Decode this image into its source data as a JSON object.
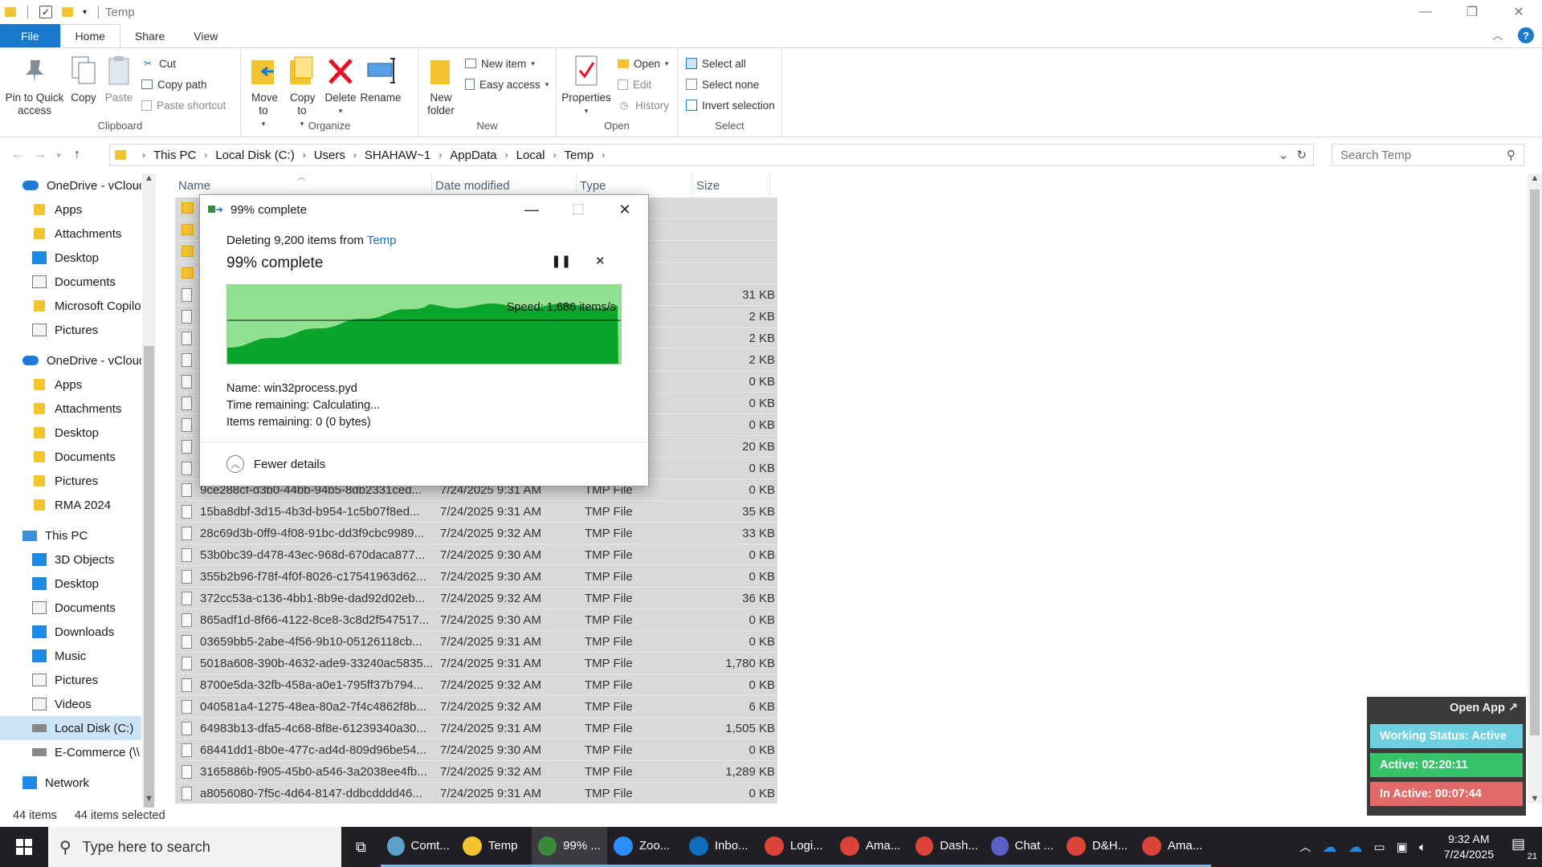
{
  "window": {
    "title": "Temp"
  },
  "tabs": {
    "file": "File",
    "home": "Home",
    "share": "Share",
    "view": "View"
  },
  "ribbon": {
    "clipboard": {
      "label": "Clipboard",
      "pin": "Pin to Quick access",
      "copy": "Copy",
      "paste": "Paste",
      "cut": "Cut",
      "copy_path": "Copy path",
      "paste_shortcut": "Paste shortcut"
    },
    "organize": {
      "label": "Organize",
      "move_to": "Move to",
      "copy_to": "Copy to",
      "delete": "Delete",
      "rename": "Rename"
    },
    "new": {
      "label": "New",
      "new_folder": "New folder",
      "new_item": "New item",
      "easy_access": "Easy access"
    },
    "open": {
      "label": "Open",
      "properties": "Properties",
      "open": "Open",
      "edit": "Edit",
      "history": "History"
    },
    "select": {
      "label": "Select",
      "select_all": "Select all",
      "select_none": "Select none",
      "invert": "Invert selection"
    }
  },
  "address": {
    "crumbs": [
      "This PC",
      "Local Disk (C:)",
      "Users",
      "SHAHAW~1",
      "AppData",
      "Local",
      "Temp"
    ],
    "search_placeholder": "Search Temp"
  },
  "nav": {
    "items": [
      {
        "label": "OneDrive - vCloud",
        "kind": "cloud"
      },
      {
        "label": "Apps",
        "kind": "folder"
      },
      {
        "label": "Attachments",
        "kind": "folder"
      },
      {
        "label": "Desktop",
        "kind": "blue"
      },
      {
        "label": "Documents",
        "kind": "doc"
      },
      {
        "label": "Microsoft Copilot",
        "kind": "folder"
      },
      {
        "label": "Pictures",
        "kind": "doc"
      },
      {
        "label": "OneDrive - vCloud",
        "kind": "cloud"
      },
      {
        "label": "Apps",
        "kind": "folder"
      },
      {
        "label": "Attachments",
        "kind": "folder"
      },
      {
        "label": "Desktop",
        "kind": "folder"
      },
      {
        "label": "Documents",
        "kind": "folder"
      },
      {
        "label": "Pictures",
        "kind": "folder"
      },
      {
        "label": "RMA 2024",
        "kind": "folder"
      },
      {
        "label": "This PC",
        "kind": "pc"
      },
      {
        "label": "3D Objects",
        "kind": "blue"
      },
      {
        "label": "Desktop",
        "kind": "blue"
      },
      {
        "label": "Documents",
        "kind": "doc"
      },
      {
        "label": "Downloads",
        "kind": "blue"
      },
      {
        "label": "Music",
        "kind": "blue"
      },
      {
        "label": "Pictures",
        "kind": "doc"
      },
      {
        "label": "Videos",
        "kind": "doc"
      },
      {
        "label": "Local Disk (C:)",
        "kind": "disk"
      },
      {
        "label": "E-Commerce (\\\\",
        "kind": "disk"
      },
      {
        "label": "Network",
        "kind": "blue"
      }
    ]
  },
  "columns": {
    "name": "Name",
    "date": "Date modified",
    "type": "Type",
    "size": "Size"
  },
  "files": [
    {
      "name": "",
      "date": "",
      "type": "",
      "size": "",
      "folder": true
    },
    {
      "name": "",
      "date": "",
      "type": "",
      "size": "",
      "folder": true
    },
    {
      "name": "",
      "date": "",
      "type": "",
      "size": "",
      "folder": true
    },
    {
      "name": "",
      "date": "",
      "type": "",
      "size": "",
      "folder": true
    },
    {
      "name": "",
      "date": "",
      "type": "",
      "size": "31 KB"
    },
    {
      "name": "",
      "date": "",
      "type": "",
      "size": "2 KB"
    },
    {
      "name": "",
      "date": "",
      "type": "",
      "size": "2 KB"
    },
    {
      "name": "",
      "date": "",
      "type": "",
      "size": "2 KB"
    },
    {
      "name": "",
      "date": "",
      "type": "",
      "size": "0 KB"
    },
    {
      "name": "",
      "date": "",
      "type": "",
      "size": "0 KB"
    },
    {
      "name": "",
      "date": "",
      "type": "",
      "size": "0 KB"
    },
    {
      "name": "",
      "date": "",
      "type": "",
      "size": "20 KB"
    },
    {
      "name": "",
      "date": "",
      "type": "",
      "size": "0 KB"
    },
    {
      "name": "9ce288cf-d3b0-44bb-94b5-8db2331ced...",
      "date": "7/24/2025 9:31 AM",
      "type": "TMP File",
      "size": "0 KB"
    },
    {
      "name": "15ba8dbf-3d15-4b3d-b954-1c5b07f8ed...",
      "date": "7/24/2025 9:31 AM",
      "type": "TMP File",
      "size": "35 KB"
    },
    {
      "name": "28c69d3b-0ff9-4f08-91bc-dd3f9cbc9989...",
      "date": "7/24/2025 9:32 AM",
      "type": "TMP File",
      "size": "33 KB"
    },
    {
      "name": "53b0bc39-d478-43ec-968d-670daca877...",
      "date": "7/24/2025 9:30 AM",
      "type": "TMP File",
      "size": "0 KB"
    },
    {
      "name": "355b2b96-f78f-4f0f-8026-c17541963d62...",
      "date": "7/24/2025 9:30 AM",
      "type": "TMP File",
      "size": "0 KB"
    },
    {
      "name": "372cc53a-c136-4bb1-8b9e-dad92d02eb...",
      "date": "7/24/2025 9:32 AM",
      "type": "TMP File",
      "size": "36 KB"
    },
    {
      "name": "865adf1d-8f66-4122-8ce8-3c8d2f547517...",
      "date": "7/24/2025 9:30 AM",
      "type": "TMP File",
      "size": "0 KB"
    },
    {
      "name": "03659bb5-2abe-4f56-9b10-05126118cb...",
      "date": "7/24/2025 9:31 AM",
      "type": "TMP File",
      "size": "0 KB"
    },
    {
      "name": "5018a608-390b-4632-ade9-33240ac5835...",
      "date": "7/24/2025 9:31 AM",
      "type": "TMP File",
      "size": "1,780 KB"
    },
    {
      "name": "8700e5da-32fb-458a-a0e1-795ff37b794...",
      "date": "7/24/2025 9:32 AM",
      "type": "TMP File",
      "size": "0 KB"
    },
    {
      "name": "040581a4-1275-48ea-80a2-7f4c4862f8b...",
      "date": "7/24/2025 9:32 AM",
      "type": "TMP File",
      "size": "6 KB"
    },
    {
      "name": "64983b13-dfa5-4c68-8f8e-61239340a30...",
      "date": "7/24/2025 9:31 AM",
      "type": "TMP File",
      "size": "1,505 KB"
    },
    {
      "name": "68441dd1-8b0e-477c-ad4d-809d96be54...",
      "date": "7/24/2025 9:30 AM",
      "type": "TMP File",
      "size": "0 KB"
    },
    {
      "name": "3165886b-f905-45b0-a546-3a2038ee4fb...",
      "date": "7/24/2025 9:32 AM",
      "type": "TMP File",
      "size": "1,289 KB"
    },
    {
      "name": "a8056080-7f5c-4d64-8147-ddbcdddd46...",
      "date": "7/24/2025 9:31 AM",
      "type": "TMP File",
      "size": "0 KB"
    }
  ],
  "status": {
    "count": "44 items",
    "selected": "44 items selected"
  },
  "dialog": {
    "title": "99% complete",
    "line_prefix": "Deleting 9,200 items from ",
    "line_link": "Temp",
    "heading": "99% complete",
    "speed": "Speed: 1,686 items/s",
    "progress": 0.99,
    "name_line": "Name: win32process.pyd",
    "time_line": "Time remaining: Calculating...",
    "items_line": "Items remaining: 0 (0 bytes)",
    "fewer": "Fewer details"
  },
  "tracker": {
    "open_app": "Open App ↗",
    "status": "Working Status: Active",
    "active": "Active: 02:20:11",
    "inactive": "In Active: 00:07:44",
    "colors": {
      "status": "#6fd1df",
      "active": "#36c36a",
      "inactive": "#e46a6a"
    }
  },
  "taskbar": {
    "search_placeholder": "Type here to search",
    "apps": [
      {
        "label": "Comt...",
        "color": "#5aa0c8"
      },
      {
        "label": "Temp",
        "color": "#f4c430"
      },
      {
        "label": "99% ...",
        "color": "#3b8a3b",
        "active": true
      },
      {
        "label": "Zoo...",
        "color": "#2d8cff"
      },
      {
        "label": "Inbo...",
        "color": "#0f6cbd"
      },
      {
        "label": "Logi...",
        "color": "#db4437"
      },
      {
        "label": "Ama...",
        "color": "#db4437"
      },
      {
        "label": "Dash...",
        "color": "#db4437"
      },
      {
        "label": "Chat ...",
        "color": "#5b5fc7"
      },
      {
        "label": "D&H...",
        "color": "#db4437"
      },
      {
        "label": "Ama...",
        "color": "#db4437"
      }
    ],
    "time": "9:32 AM",
    "date": "7/24/2025",
    "notif_count": "21"
  }
}
